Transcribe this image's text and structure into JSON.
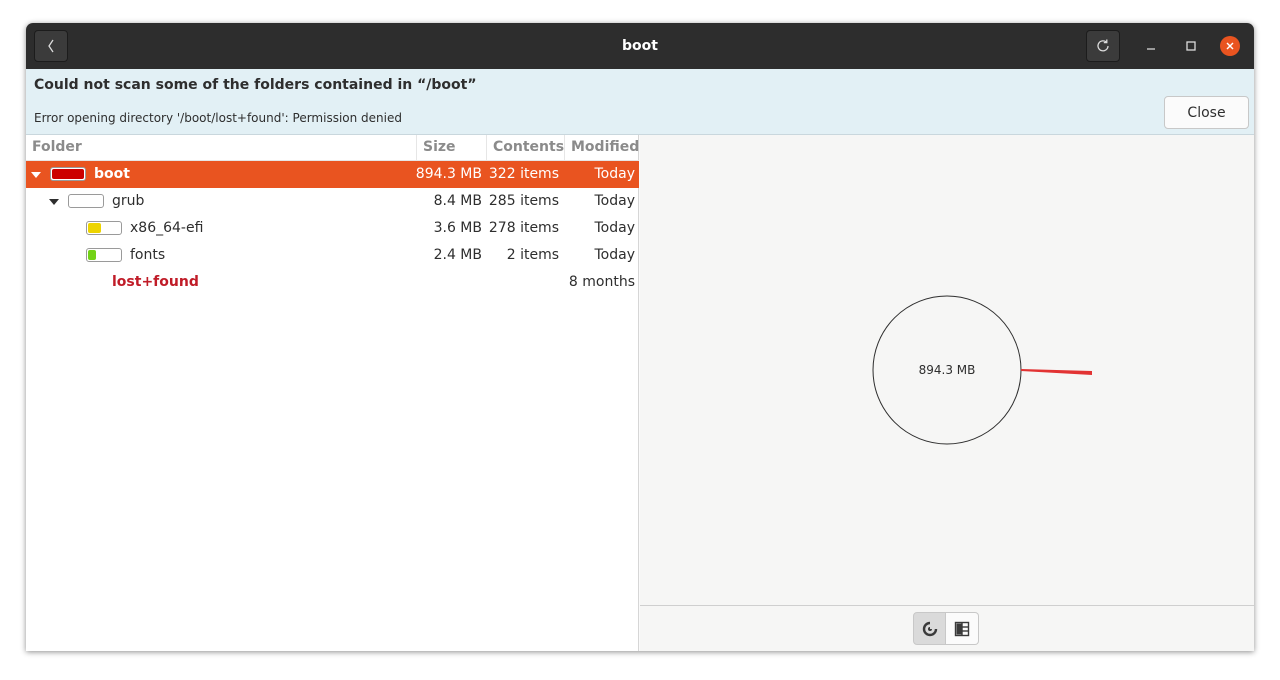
{
  "window": {
    "title": "boot"
  },
  "header": {
    "back_icon": "chevron-left-icon",
    "reload_icon": "reload-icon"
  },
  "infobar": {
    "title": "Could not scan some of the folders contained in “/boot”",
    "message": "Error opening directory '/boot/lost+found': Permission denied",
    "close_label": "Close"
  },
  "columns": {
    "folder": "Folder",
    "size": "Size",
    "contents": "Contents",
    "modified": "Modified"
  },
  "rows": [
    {
      "name": "boot",
      "size": "894.3 MB",
      "contents": "322 items",
      "modified": "Today",
      "color": "#cc0000",
      "fill_fraction": 1.0
    },
    {
      "name": "grub",
      "size": "8.4 MB",
      "contents": "285 items",
      "modified": "Today",
      "color": "#ffffff",
      "fill_fraction": 0.0
    },
    {
      "name": "x86_64-efi",
      "size": "3.6 MB",
      "contents": "278 items",
      "modified": "Today",
      "color": "#edd400",
      "fill_fraction": 0.43
    },
    {
      "name": "fonts",
      "size": "2.4 MB",
      "contents": "2 items",
      "modified": "Today",
      "color": "#73d216",
      "fill_fraction": 0.29
    },
    {
      "name": "lost+found",
      "size": "",
      "contents": "",
      "modified": "8 months",
      "color": "#c01c28"
    }
  ],
  "ring_chart": {
    "center_label": "894.3 MB",
    "segment_color": "#e23333"
  },
  "view_toggle": {
    "ring_icon": "ring-chart-icon",
    "treemap_icon": "treemap-icon"
  }
}
